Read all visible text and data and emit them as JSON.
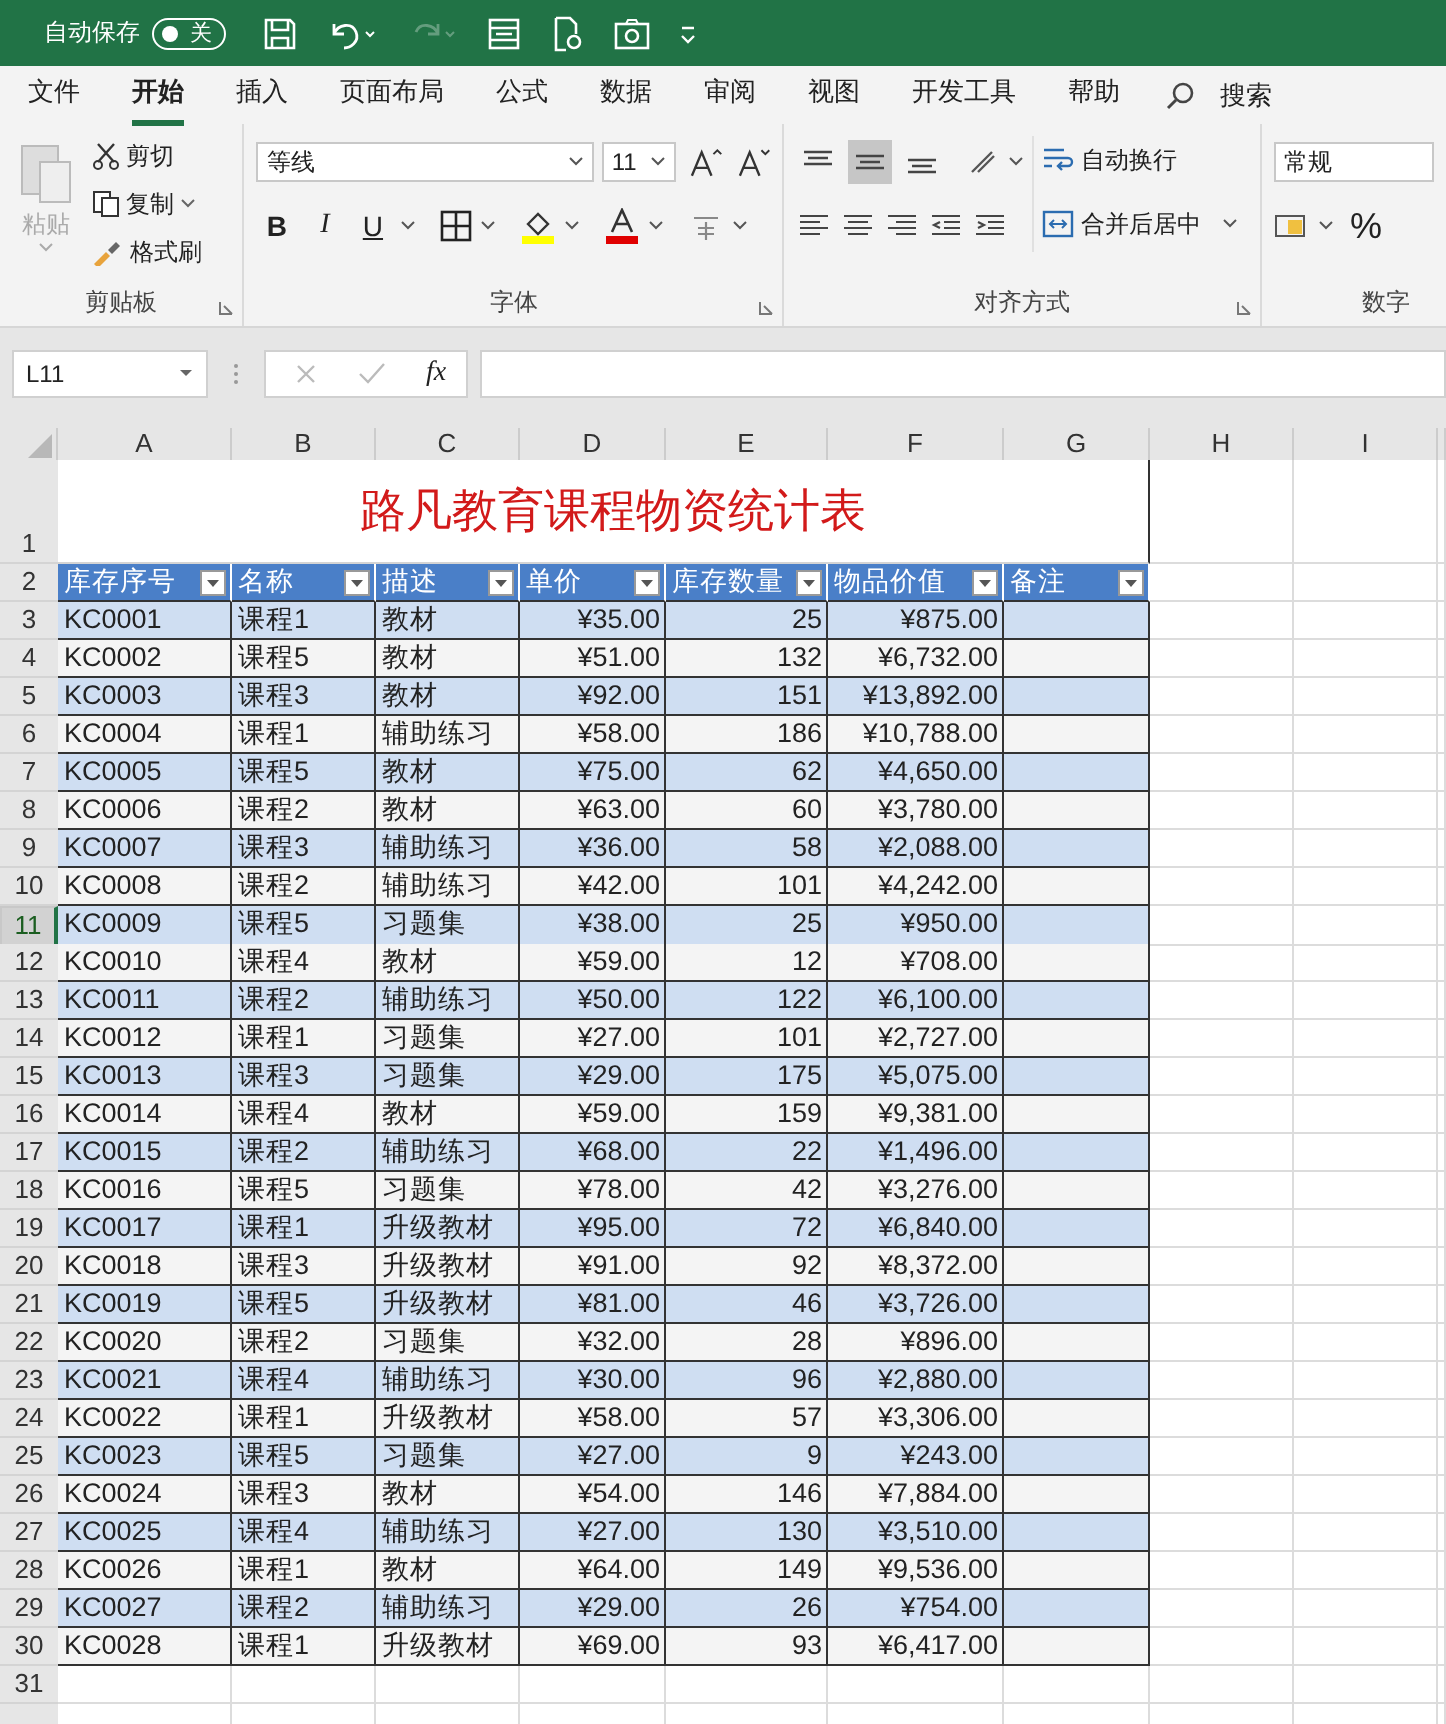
{
  "title_bar": {
    "autosave_label": "自动保存",
    "autosave_toggle": {
      "on": false,
      "label": "关"
    },
    "redo": {
      "disabled": true
    }
  },
  "tabs": [
    {
      "label": "文件",
      "selected": false
    },
    {
      "label": "开始",
      "selected": true
    },
    {
      "label": "插入",
      "selected": false
    },
    {
      "label": "页面布局",
      "selected": false
    },
    {
      "label": "公式",
      "selected": false
    },
    {
      "label": "数据",
      "selected": false
    },
    {
      "label": "审阅",
      "selected": false
    },
    {
      "label": "视图",
      "selected": false
    },
    {
      "label": "开发工具",
      "selected": false
    },
    {
      "label": "帮助",
      "selected": false
    }
  ],
  "search": {
    "label": "搜索"
  },
  "ribbon": {
    "clipboard": {
      "title": "剪贴板",
      "paste": {
        "label": "粘贴",
        "disabled": true
      },
      "cut": "剪切",
      "copy": "复制",
      "format_painter": "格式刷"
    },
    "font": {
      "title": "字体",
      "font_name": "等线",
      "font_size": "11",
      "bold": "B",
      "italic": "I",
      "underline": "U"
    },
    "alignment": {
      "title": "对齐方式",
      "vertical": [
        {
          "selected": false
        },
        {
          "selected": true
        },
        {
          "selected": false
        }
      ],
      "wrap_text": "自动换行",
      "merge_center": "合并后居中"
    },
    "number": {
      "title": "数字",
      "format": "常规",
      "percent": "%"
    }
  },
  "formula_bar": {
    "name_box": "L11",
    "fx": "fx"
  },
  "columns": [
    "A",
    "B",
    "C",
    "D",
    "E",
    "F",
    "G",
    "H",
    "I"
  ],
  "row_numbers": [
    {
      "label": "1",
      "selected": false
    },
    {
      "label": "2",
      "selected": false
    },
    {
      "label": "3",
      "selected": false
    },
    {
      "label": "4",
      "selected": false
    },
    {
      "label": "5",
      "selected": false
    },
    {
      "label": "6",
      "selected": false
    },
    {
      "label": "7",
      "selected": false
    },
    {
      "label": "8",
      "selected": false
    },
    {
      "label": "9",
      "selected": false
    },
    {
      "label": "10",
      "selected": false
    },
    {
      "label": "11",
      "selected": true
    },
    {
      "label": "12",
      "selected": false
    },
    {
      "label": "13",
      "selected": false
    },
    {
      "label": "14",
      "selected": false
    },
    {
      "label": "15",
      "selected": false
    },
    {
      "label": "16",
      "selected": false
    },
    {
      "label": "17",
      "selected": false
    },
    {
      "label": "18",
      "selected": false
    },
    {
      "label": "19",
      "selected": false
    },
    {
      "label": "20",
      "selected": false
    },
    {
      "label": "21",
      "selected": false
    },
    {
      "label": "22",
      "selected": false
    },
    {
      "label": "23",
      "selected": false
    },
    {
      "label": "24",
      "selected": false
    },
    {
      "label": "25",
      "selected": false
    },
    {
      "label": "26",
      "selected": false
    },
    {
      "label": "27",
      "selected": false
    },
    {
      "label": "28",
      "selected": false
    },
    {
      "label": "29",
      "selected": false
    },
    {
      "label": "30",
      "selected": false
    },
    {
      "label": "31",
      "selected": false
    }
  ],
  "sheet": {
    "title": "路凡教育课程物资统计表",
    "headers": [
      "库存序号",
      "名称",
      "描述",
      "单价",
      "库存数量",
      "物品价值",
      "备注"
    ],
    "rows": [
      [
        "KC0001",
        "课程1",
        "教材",
        "¥35.00",
        "25",
        "¥875.00"
      ],
      [
        "KC0002",
        "课程5",
        "教材",
        "¥51.00",
        "132",
        "¥6,732.00"
      ],
      [
        "KC0003",
        "课程3",
        "教材",
        "¥92.00",
        "151",
        "¥13,892.00"
      ],
      [
        "KC0004",
        "课程1",
        "辅助练习",
        "¥58.00",
        "186",
        "¥10,788.00"
      ],
      [
        "KC0005",
        "课程5",
        "教材",
        "¥75.00",
        "62",
        "¥4,650.00"
      ],
      [
        "KC0006",
        "课程2",
        "教材",
        "¥63.00",
        "60",
        "¥3,780.00"
      ],
      [
        "KC0007",
        "课程3",
        "辅助练习",
        "¥36.00",
        "58",
        "¥2,088.00"
      ],
      [
        "KC0008",
        "课程2",
        "辅助练习",
        "¥42.00",
        "101",
        "¥4,242.00"
      ],
      [
        "KC0009",
        "课程5",
        "习题集",
        "¥38.00",
        "25",
        "¥950.00"
      ],
      [
        "KC0010",
        "课程4",
        "教材",
        "¥59.00",
        "12",
        "¥708.00"
      ],
      [
        "KC0011",
        "课程2",
        "辅助练习",
        "¥50.00",
        "122",
        "¥6,100.00"
      ],
      [
        "KC0012",
        "课程1",
        "习题集",
        "¥27.00",
        "101",
        "¥2,727.00"
      ],
      [
        "KC0013",
        "课程3",
        "习题集",
        "¥29.00",
        "175",
        "¥5,075.00"
      ],
      [
        "KC0014",
        "课程4",
        "教材",
        "¥59.00",
        "159",
        "¥9,381.00"
      ],
      [
        "KC0015",
        "课程2",
        "辅助练习",
        "¥68.00",
        "22",
        "¥1,496.00"
      ],
      [
        "KC0016",
        "课程5",
        "习题集",
        "¥78.00",
        "42",
        "¥3,276.00"
      ],
      [
        "KC0017",
        "课程1",
        "升级教材",
        "¥95.00",
        "72",
        "¥6,840.00"
      ],
      [
        "KC0018",
        "课程3",
        "升级教材",
        "¥91.00",
        "92",
        "¥8,372.00"
      ],
      [
        "KC0019",
        "课程5",
        "升级教材",
        "¥81.00",
        "46",
        "¥3,726.00"
      ],
      [
        "KC0020",
        "课程2",
        "习题集",
        "¥32.00",
        "28",
        "¥896.00"
      ],
      [
        "KC0021",
        "课程4",
        "辅助练习",
        "¥30.00",
        "96",
        "¥2,880.00"
      ],
      [
        "KC0022",
        "课程1",
        "升级教材",
        "¥58.00",
        "57",
        "¥3,306.00"
      ],
      [
        "KC0023",
        "课程5",
        "习题集",
        "¥27.00",
        "9",
        "¥243.00"
      ],
      [
        "KC0024",
        "课程3",
        "教材",
        "¥54.00",
        "146",
        "¥7,884.00"
      ],
      [
        "KC0025",
        "课程4",
        "辅助练习",
        "¥27.00",
        "130",
        "¥3,510.00"
      ],
      [
        "KC0026",
        "课程1",
        "教材",
        "¥64.00",
        "149",
        "¥9,536.00"
      ],
      [
        "KC0027",
        "课程2",
        "辅助练习",
        "¥29.00",
        "26",
        "¥754.00"
      ],
      [
        "KC0028",
        "课程1",
        "升级教材",
        "¥69.00",
        "93",
        "¥6,417.00"
      ]
    ]
  }
}
